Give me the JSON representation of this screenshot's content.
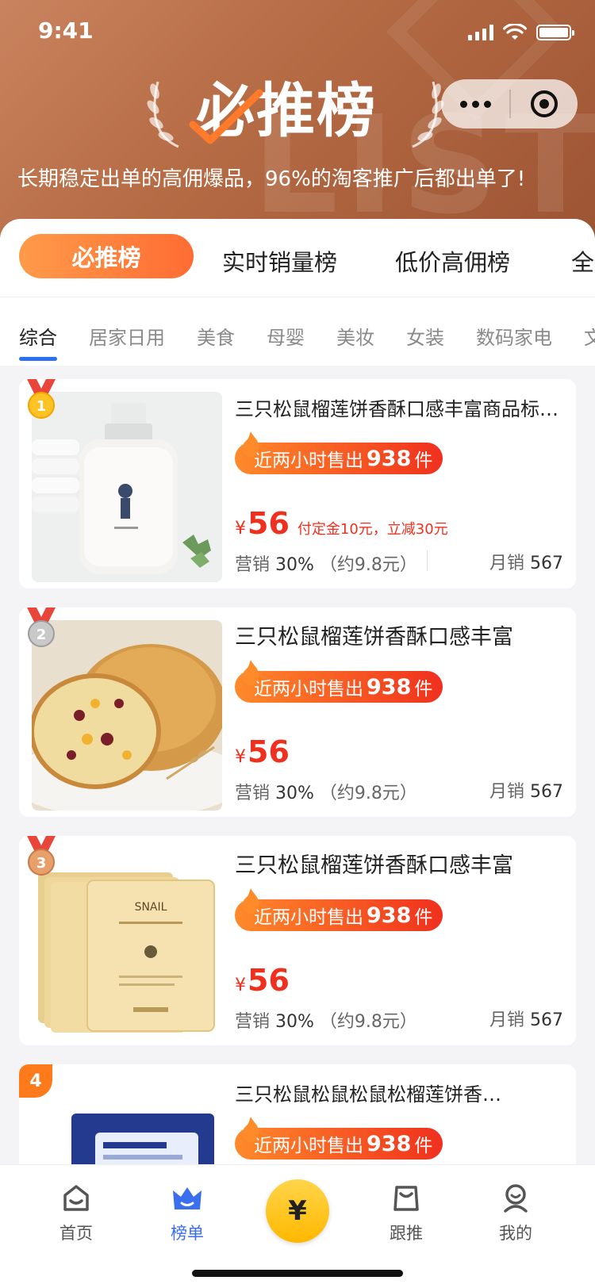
{
  "status": {
    "time": "9:41"
  },
  "header": {
    "title": "必推榜",
    "subtitle": "长期稳定出单的高佣爆品，96%的淘客推广后都出单了!",
    "watermark": "LIST"
  },
  "main_tabs": [
    "必推榜",
    "实时销量榜",
    "低价高佣榜",
    "全"
  ],
  "sub_tabs": [
    "综合",
    "居家日用",
    "美食",
    "母婴",
    "美妆",
    "女装",
    "数码家电",
    "文"
  ],
  "products": [
    {
      "rank": "1",
      "title": "三只松鼠榴莲饼香酥口感丰富商品标…",
      "hot_prefix": "近两小时售出",
      "hot_count": "938",
      "hot_suffix": "件",
      "price_symbol": "¥",
      "price": "56",
      "promo": "付定金10元，立减30元",
      "commission_label": "营销",
      "commission": "30%",
      "commission_amount": "（约9.8元）",
      "monthly_label": "月销",
      "monthly": "567",
      "image": "body-wash-bottle"
    },
    {
      "rank": "2",
      "title": "三只松鼠榴莲饼香酥口感丰富",
      "hot_prefix": "近两小时售出",
      "hot_count": "938",
      "hot_suffix": "件",
      "price_symbol": "¥",
      "price": "56",
      "commission_label": "营销",
      "commission": "30%",
      "commission_amount": "（约9.8元）",
      "monthly_label": "月销",
      "monthly": "567",
      "image": "bread-loaf"
    },
    {
      "rank": "3",
      "title": "三只松鼠榴莲饼香酥口感丰富",
      "hot_prefix": "近两小时售出",
      "hot_count": "938",
      "hot_suffix": "件",
      "price_symbol": "¥",
      "price": "56",
      "commission_label": "营销",
      "commission": "30%",
      "commission_amount": "（约9.8元）",
      "monthly_label": "月销",
      "monthly": "567",
      "image": "snail-face-mask"
    },
    {
      "rank": "4",
      "title": "三只松鼠松鼠松鼠松榴莲饼香…",
      "hot_prefix": "近两小时售出",
      "hot_count": "938",
      "hot_suffix": "件",
      "image": "lactobacillus-box"
    }
  ],
  "nav": {
    "items": [
      {
        "label": "首页",
        "icon": "home-icon"
      },
      {
        "label": "榜单",
        "icon": "crown-icon"
      },
      {
        "label": "¥",
        "icon": "yuan-icon"
      },
      {
        "label": "跟推",
        "icon": "bag-icon"
      },
      {
        "label": "我的",
        "icon": "profile-icon"
      }
    ]
  },
  "colors": {
    "header_brown": "#b46a43",
    "accent_orange": "#ff6c33",
    "price_red": "#f0301e",
    "active_blue": "#3a6ff0",
    "center_yellow": "#ffc21a"
  }
}
